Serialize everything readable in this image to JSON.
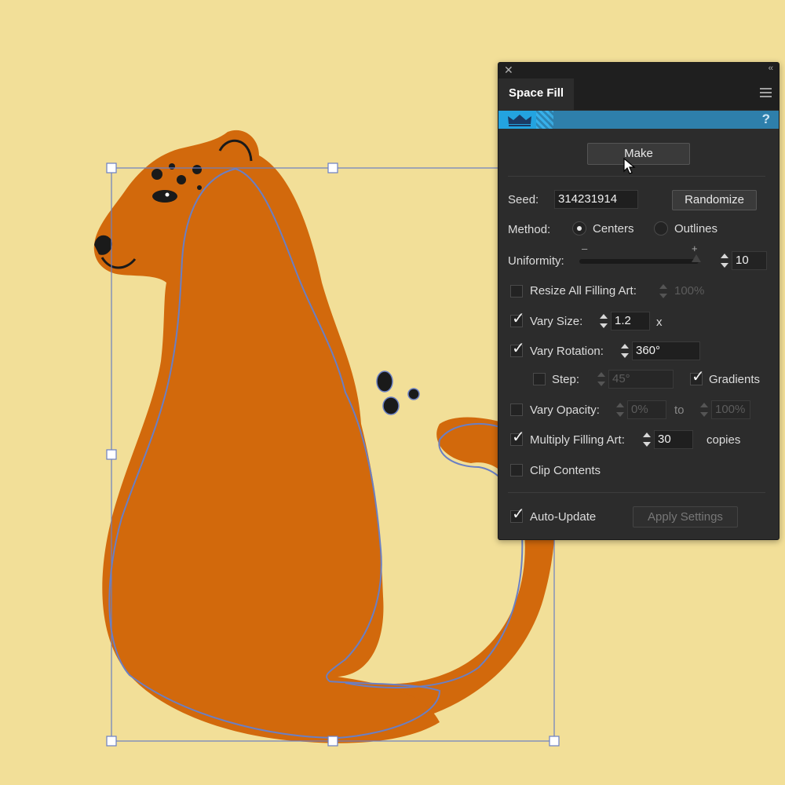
{
  "panel": {
    "tab_title": "Space Fill",
    "help_label": "?",
    "make_label": "Make",
    "seed": {
      "label": "Seed:",
      "value": "314231914"
    },
    "randomize_label": "Randomize",
    "method": {
      "label": "Method:",
      "options": [
        "Centers",
        "Outlines"
      ],
      "selected": "Centers"
    },
    "uniformity": {
      "label": "Uniformity:",
      "min_symbol": "–",
      "max_symbol": "+",
      "value": "10",
      "slider_fraction": 0.98
    },
    "resize_all": {
      "label": "Resize All Filling Art:",
      "checked": false,
      "value": "100%"
    },
    "vary_size": {
      "label": "Vary Size:",
      "checked": true,
      "value": "1.2",
      "unit": "x"
    },
    "vary_rotation": {
      "label": "Vary Rotation:",
      "checked": true,
      "value": "360°"
    },
    "step": {
      "label": "Step:",
      "checked": false,
      "value": "45°"
    },
    "gradients": {
      "label": "Gradients",
      "checked": true
    },
    "vary_opacity": {
      "label": "Vary Opacity:",
      "checked": false,
      "from": "0%",
      "to_label": "to",
      "to": "100%"
    },
    "multiply": {
      "label": "Multiply Filling Art:",
      "checked": true,
      "value": "30",
      "unit": "copies"
    },
    "clip_contents": {
      "label": "Clip Contents",
      "checked": false
    },
    "auto_update": {
      "label": "Auto-Update",
      "checked": true
    },
    "apply_label": "Apply Settings"
  },
  "colors": {
    "canvas_bg": "#f2df98",
    "cat_body": "#d2690c",
    "spots": "#1a1a1a",
    "selection": "#6a7fc4",
    "panel_bg": "#2c2c2c",
    "brand_blue": "#23a3e0"
  },
  "icons": {
    "crown": "crown-icon",
    "close": "close-icon",
    "collapse": "double-chevron-icon",
    "menu": "hamburger-menu-icon",
    "cursor": "arrow-cursor-icon"
  }
}
